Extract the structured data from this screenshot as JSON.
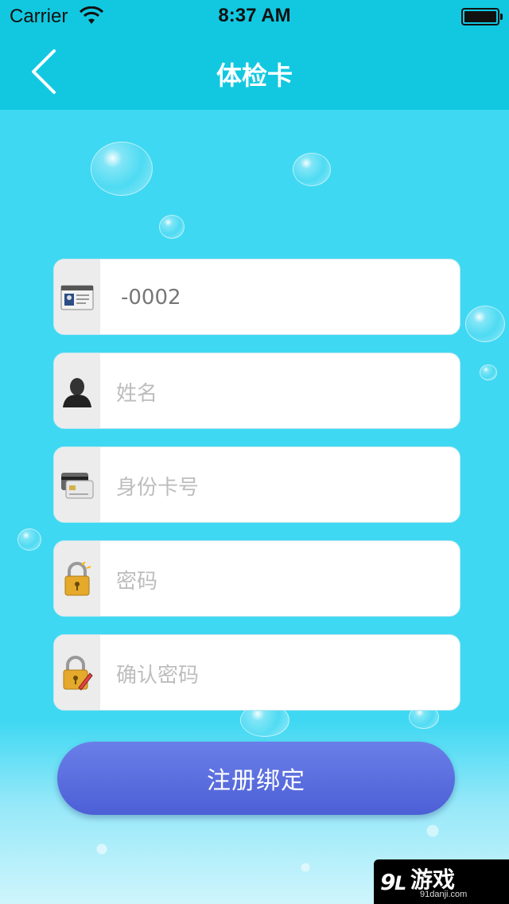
{
  "status_bar": {
    "carrier": "Carrier",
    "time": "8:37 AM"
  },
  "nav": {
    "title": "体检卡",
    "back_icon": "chevron-left-icon"
  },
  "form": {
    "card_number": {
      "value": "-0002",
      "icon": "id-card-icon"
    },
    "name": {
      "placeholder": "姓名",
      "icon": "user-silhouette-icon"
    },
    "id_card": {
      "placeholder": "身份卡号",
      "icon": "credit-card-icon"
    },
    "password": {
      "placeholder": "密码",
      "icon": "padlock-icon"
    },
    "confirm_password": {
      "placeholder": "确认密码",
      "icon": "padlock-pen-icon"
    }
  },
  "submit_label": "注册绑定",
  "watermark": {
    "brand": "游戏",
    "site": "91danji.com"
  },
  "colors": {
    "nav": "#12c8e0",
    "background": "#3fd8f2",
    "button": "#5567dc"
  }
}
